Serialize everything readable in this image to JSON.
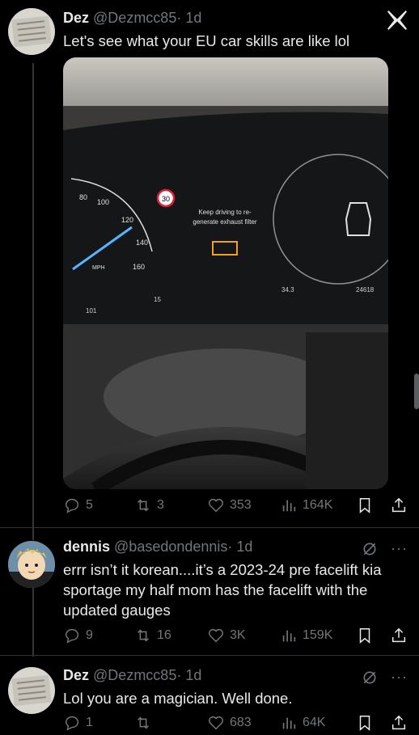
{
  "tweet1": {
    "name": "Dez",
    "handle": "@Dezmcc85",
    "time": "· 1d",
    "text": "Let's see what your EU car skills are like lol",
    "media": {
      "warning_line1": "Keep driving to re-",
      "warning_line2": "generate exhaust filter",
      "speed_limit": "30",
      "mph_label": "MPH",
      "speed_ticks": [
        "80",
        "100",
        "120",
        "140",
        "160"
      ],
      "temp": "15",
      "range": "101",
      "trip": "34.3",
      "odometer": "24618"
    },
    "actions": {
      "replies": "5",
      "reposts": "3",
      "likes": "353",
      "views": "164K"
    }
  },
  "tweet2": {
    "name": "dennis",
    "handle": "@basedondennis",
    "time": "· 1d",
    "text": "errr isn’t it korean....it’s a 2023-24 pre facelift kia sportage my half mom has the facelift with the updated gauges",
    "actions": {
      "replies": "9",
      "reposts": "16",
      "likes": "3K",
      "views": "159K"
    }
  },
  "tweet3": {
    "name": "Dez",
    "handle": "@Dezmcc85",
    "time": "· 1d",
    "text": "Lol you are a magician. Well done.",
    "actions": {
      "replies": "1",
      "reposts": "",
      "likes": "683",
      "views": "64K"
    }
  },
  "icons": {
    "x_logo": "x-logo-icon",
    "reply": "reply-icon",
    "repost": "repost-icon",
    "like": "heart-icon",
    "views": "views-icon",
    "bookmark": "bookmark-icon",
    "share": "share-icon",
    "grok": "grok-icon",
    "more": "more-icon"
  },
  "colors": {
    "background": "#000000",
    "text": "#e7e9ea",
    "muted": "#71767b",
    "divider": "#333639"
  }
}
